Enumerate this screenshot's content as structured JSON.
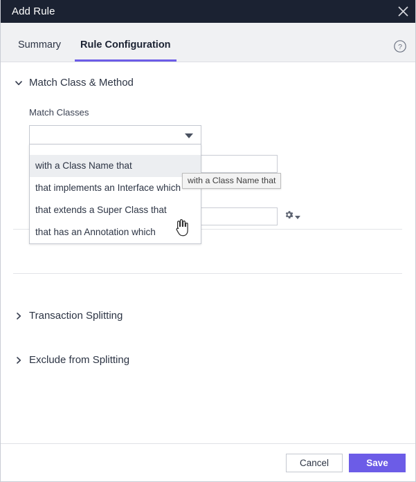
{
  "window": {
    "title": "Add Rule",
    "close_label": "×"
  },
  "tabs": [
    {
      "label": "Summary",
      "active": false
    },
    {
      "label": "Rule Configuration",
      "active": true
    }
  ],
  "help": {
    "icon": "help-circle-icon"
  },
  "sections": [
    {
      "id": "match-class-method",
      "title": "Match Class & Method",
      "expanded": true
    },
    {
      "id": "transaction-splitting",
      "title": "Transaction Splitting",
      "expanded": false
    },
    {
      "id": "exclude-from-splitting",
      "title": "Exclude from Splitting",
      "expanded": false
    }
  ],
  "match_classes": {
    "label": "Match Classes",
    "selected_value": "",
    "placeholder": "",
    "options": [
      "with a Class Name that",
      "that implements an Interface which",
      "that extends a Super Class that",
      "that has an Annotation which"
    ],
    "hovered_option_index": 0
  },
  "inputs": [
    {
      "name": "class-name-condition-input",
      "value": "",
      "placeholder": ""
    },
    {
      "name": "class-name-value-input",
      "value": "",
      "placeholder": ""
    }
  ],
  "gear": {
    "icon": "gear-icon",
    "caret": "chevron-down-icon"
  },
  "tooltip": {
    "text": "with a Class Name that"
  },
  "cursor": {
    "type": "pointer-hand-cursor"
  },
  "footer": {
    "cancel_label": "Cancel",
    "save_label": "Save"
  },
  "colors": {
    "titlebar_bg": "#1b2232",
    "accent": "#6c5ce7",
    "tabbar_bg": "#f0f1f3",
    "hover_bg": "#eceef1",
    "border": "#c4c8d0"
  }
}
